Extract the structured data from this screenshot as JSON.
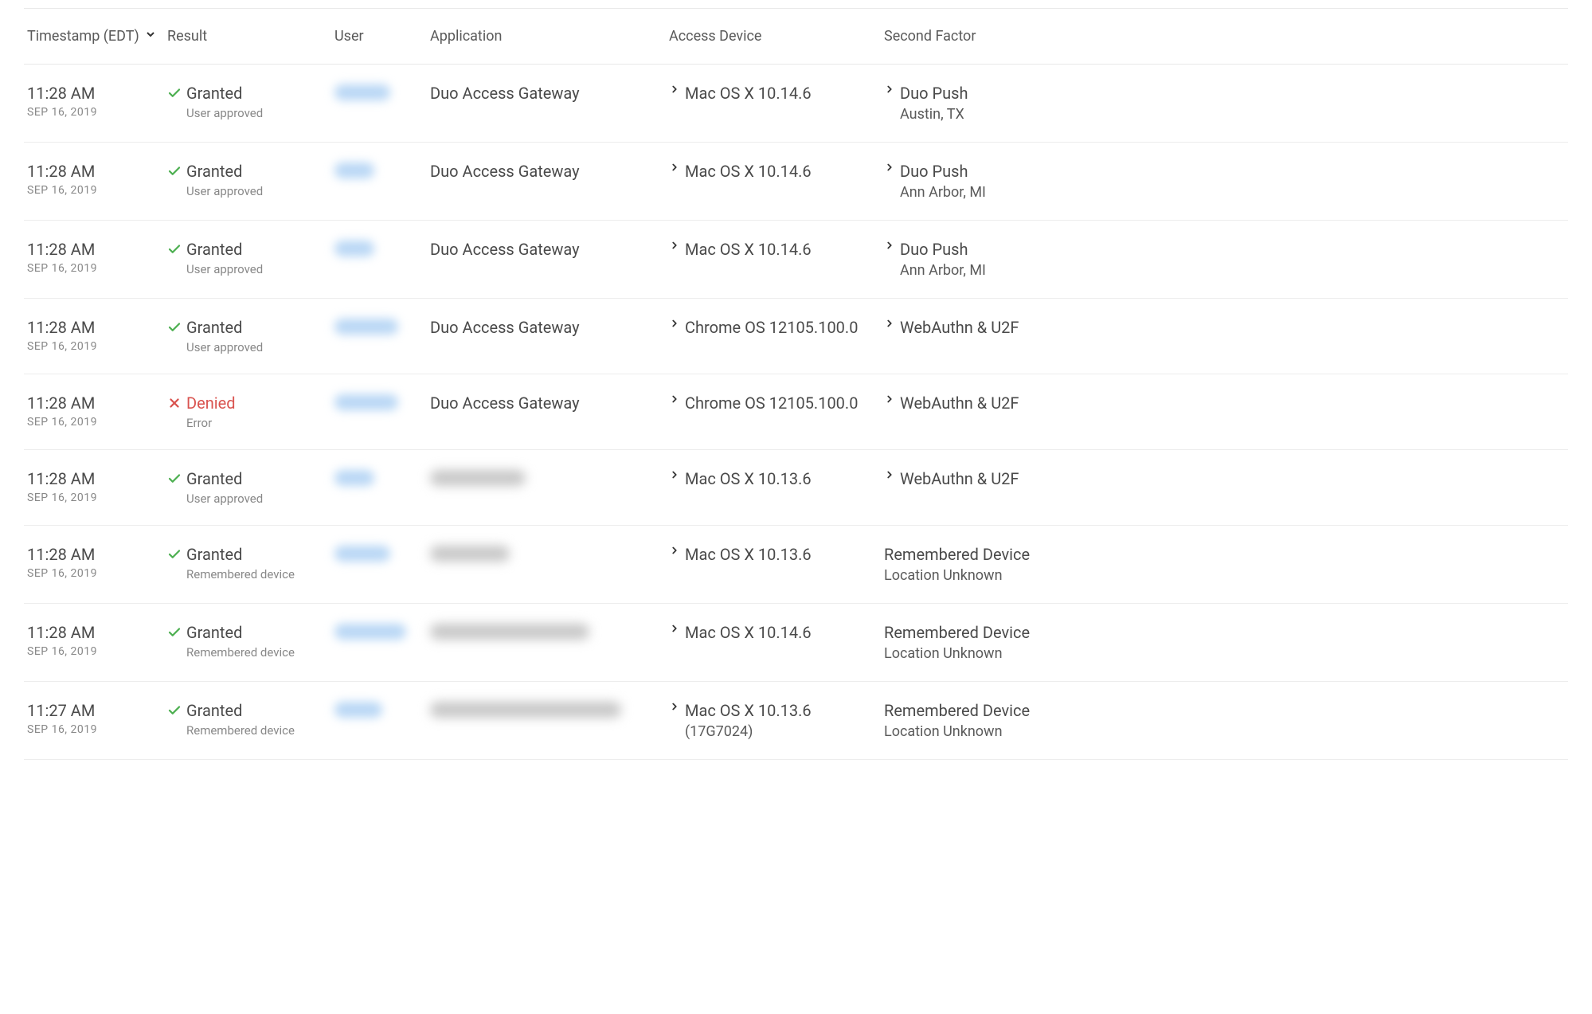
{
  "headers": {
    "timestamp": "Timestamp (EDT)",
    "result": "Result",
    "user": "User",
    "application": "Application",
    "access_device": "Access Device",
    "second_factor": "Second Factor"
  },
  "rows": [
    {
      "time": "11:28 AM",
      "date": "SEP 16, 2019",
      "result": "Granted",
      "result_status": "granted",
      "result_sub": "User approved",
      "user_blurred": true,
      "user_blur_w": "w70",
      "app": "Duo Access Gateway",
      "app_blurred": false,
      "device": "Mac OS X 10.14.6",
      "device_sub": "",
      "device_expand": true,
      "factor": "Duo Push",
      "factor_sub": "Austin, TX",
      "factor_expand": true
    },
    {
      "time": "11:28 AM",
      "date": "SEP 16, 2019",
      "result": "Granted",
      "result_status": "granted",
      "result_sub": "User approved",
      "user_blurred": true,
      "user_blur_w": "w50",
      "app": "Duo Access Gateway",
      "app_blurred": false,
      "device": "Mac OS X 10.14.6",
      "device_sub": "",
      "device_expand": true,
      "factor": "Duo Push",
      "factor_sub": "Ann Arbor, MI",
      "factor_expand": true
    },
    {
      "time": "11:28 AM",
      "date": "SEP 16, 2019",
      "result": "Granted",
      "result_status": "granted",
      "result_sub": "User approved",
      "user_blurred": true,
      "user_blur_w": "w50",
      "app": "Duo Access Gateway",
      "app_blurred": false,
      "device": "Mac OS X 10.14.6",
      "device_sub": "",
      "device_expand": true,
      "factor": "Duo Push",
      "factor_sub": "Ann Arbor, MI",
      "factor_expand": true
    },
    {
      "time": "11:28 AM",
      "date": "SEP 16, 2019",
      "result": "Granted",
      "result_status": "granted",
      "result_sub": "User approved",
      "user_blurred": true,
      "user_blur_w": "w80",
      "app": "Duo Access Gateway",
      "app_blurred": false,
      "device": "Chrome OS 12105.100.0",
      "device_sub": "",
      "device_expand": true,
      "factor": "WebAuthn & U2F",
      "factor_sub": "",
      "factor_expand": true
    },
    {
      "time": "11:28 AM",
      "date": "SEP 16, 2019",
      "result": "Denied",
      "result_status": "denied",
      "result_sub": "Error",
      "user_blurred": true,
      "user_blur_w": "w80",
      "app": "Duo Access Gateway",
      "app_blurred": false,
      "device": "Chrome OS 12105.100.0",
      "device_sub": "",
      "device_expand": true,
      "factor": "WebAuthn & U2F",
      "factor_sub": "",
      "factor_expand": true
    },
    {
      "time": "11:28 AM",
      "date": "SEP 16, 2019",
      "result": "Granted",
      "result_status": "granted",
      "result_sub": "User approved",
      "user_blurred": true,
      "user_blur_w": "w50",
      "app": "",
      "app_blurred": true,
      "app_blur_w": "w120",
      "device": "Mac OS X 10.13.6",
      "device_sub": "",
      "device_expand": true,
      "factor": "WebAuthn & U2F",
      "factor_sub": "",
      "factor_expand": true
    },
    {
      "time": "11:28 AM",
      "date": "SEP 16, 2019",
      "result": "Granted",
      "result_status": "granted",
      "result_sub": "Remembered device",
      "user_blurred": true,
      "user_blur_w": "w70",
      "app": "",
      "app_blurred": true,
      "app_blur_w": "w100",
      "device": "Mac OS X 10.13.6",
      "device_sub": "",
      "device_expand": true,
      "factor": "Remembered Device",
      "factor_sub": "Location Unknown",
      "factor_expand": false
    },
    {
      "time": "11:28 AM",
      "date": "SEP 16, 2019",
      "result": "Granted",
      "result_status": "granted",
      "result_sub": "Remembered device",
      "user_blurred": true,
      "user_blur_w": "w90",
      "app": "",
      "app_blurred": true,
      "app_blur_w": "w200",
      "device": "Mac OS X 10.14.6",
      "device_sub": "",
      "device_expand": true,
      "factor": "Remembered Device",
      "factor_sub": "Location Unknown",
      "factor_expand": false
    },
    {
      "time": "11:27 AM",
      "date": "SEP 16, 2019",
      "result": "Granted",
      "result_status": "granted",
      "result_sub": "Remembered device",
      "user_blurred": true,
      "user_blur_w": "w60",
      "app": "",
      "app_blurred": true,
      "app_blur_w": "w240",
      "device": "Mac OS X 10.13.6",
      "device_sub": "(17G7024)",
      "device_expand": true,
      "factor": "Remembered Device",
      "factor_sub": "Location Unknown",
      "factor_expand": false
    }
  ]
}
